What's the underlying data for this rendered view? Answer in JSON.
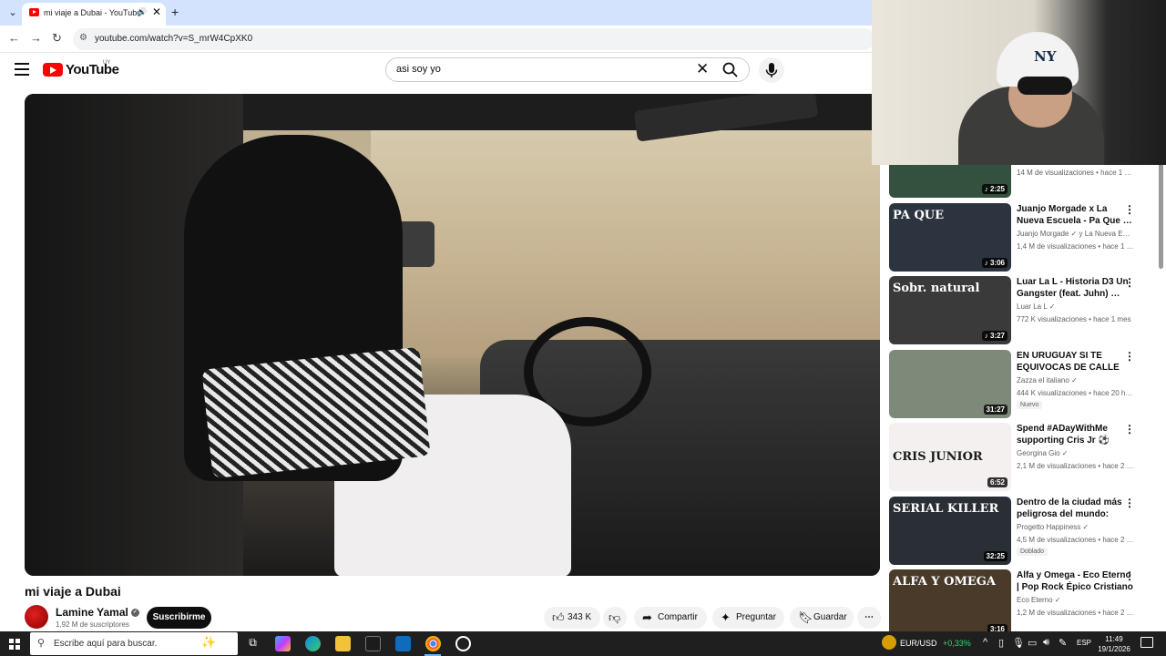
{
  "browser": {
    "tab_title": "mi viaje a Dubai - YouTube",
    "url": "youtube.com/watch?v=S_mrW4CpXK0",
    "tab_close": "✕",
    "new_tab": "+"
  },
  "youtube": {
    "logo_text": "YouTube",
    "country": "UY",
    "search_value": "asi soy yo"
  },
  "video": {
    "title": "mi viaje a Dubai",
    "channel": "Lamine Yamal",
    "subscribers": "1,92 M de suscriptores",
    "subscribe_label": "Suscribirme",
    "likes": "343 K",
    "share_label": "Compartir",
    "ask_label": "Preguntar",
    "save_label": "Guardar"
  },
  "recommendations": [
    {
      "title": "",
      "channel": "",
      "meta": "14 M de visualizaciones • hace 1 …",
      "duration": "♪ 2:25",
      "thumb_color": "#34503f",
      "thumb_label": ""
    },
    {
      "title": "Juanjo Morgade x La Nueva Escuela - Pa Que …",
      "channel": "Juanjo Morgade ✓ y La Nueva E…",
      "meta": "1,4 M de visualizaciones • hace 1 …",
      "duration": "♪ 3:06",
      "thumb_color": "#2c3440",
      "thumb_label": "PA QUE"
    },
    {
      "title": "Luar La L - Historia D3 Un Gangster (feat. Juhn) …",
      "channel": "Luar La L ✓",
      "meta": "772 K visualizaciones • hace 1 mes",
      "duration": "♪ 3:27",
      "thumb_color": "#3a3a3a",
      "thumb_label": "Sobr. natural"
    },
    {
      "title": "EN URUGUAY SI TE EQUIVOCAS DE CALLE T…",
      "channel": "Zazza el italiano ✓",
      "meta": "444 K visualizaciones • hace 20 h…",
      "duration": "31:27",
      "badge": "Nuevo",
      "thumb_color": "#7d8a7a",
      "thumb_label": ""
    },
    {
      "title": "Spend #ADayWithMe supporting Cris Jr ⚽️",
      "channel": "Georgina Gio ✓",
      "meta": "2,1 M de visualizaciones • hace 2 …",
      "duration": "6:52",
      "thumb_color": "#f4f0f0",
      "thumb_label": "CRIS JUNIOR"
    },
    {
      "title": "Dentro de la ciudad más peligrosa del mundo: vivi…",
      "channel": "Progetto Happiness ✓",
      "meta": "4,5 M de visualizaciones • hace 2 …",
      "duration": "32:25",
      "badge": "Doblado",
      "thumb_color": "#2a2f35",
      "thumb_label": "SERIAL KILLER"
    },
    {
      "title": "Alfa y Omega - Eco Eterno | Pop Rock Épico Cristiano",
      "channel": "Eco Eterno ✓",
      "meta": "1,2 M de visualizaciones • hace 2 …",
      "duration": "3:16",
      "thumb_color": "#4a3a2a",
      "thumb_label": "ALFA Y OMEGA"
    }
  ],
  "webcam": {
    "cap_logo": "NY"
  },
  "taskbar": {
    "search_placeholder": "Escribe aquí para buscar.",
    "fx_pair": "EUR/USD",
    "fx_change": "+0,33%",
    "lang": "ESP",
    "time": "11:49",
    "date": "19/1/2026"
  },
  "colors": {
    "accent_red": "#ff0000",
    "fx_green": "#3ecf73"
  }
}
